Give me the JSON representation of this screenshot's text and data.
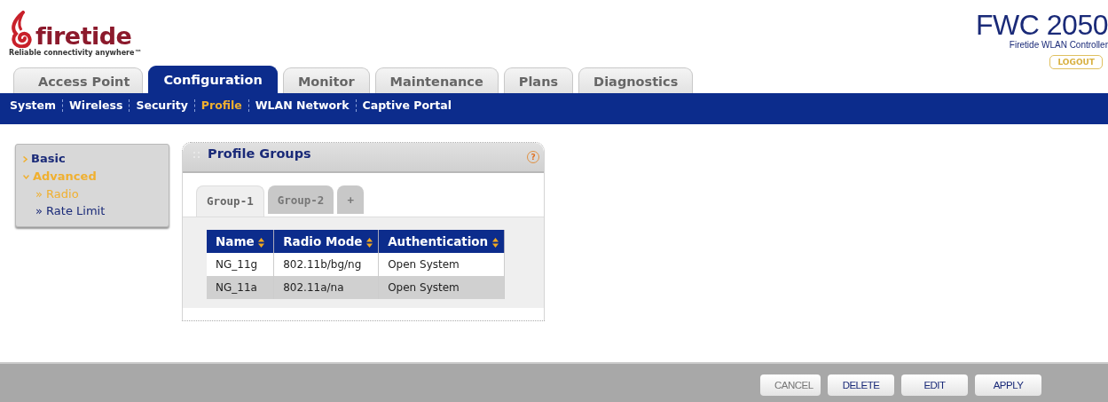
{
  "header": {
    "brand": "firetide",
    "tagline": "Reliable connectivity anywhere™",
    "product": "FWC 2050",
    "product_subtitle": "Firetide WLAN Controller",
    "logout": "LOGOUT"
  },
  "tabs": [
    {
      "label": "Access Point",
      "selected": false
    },
    {
      "label": "Configuration",
      "selected": true
    },
    {
      "label": "Monitor",
      "selected": false
    },
    {
      "label": "Maintenance",
      "selected": false
    },
    {
      "label": "Plans",
      "selected": false
    },
    {
      "label": "Diagnostics",
      "selected": false
    }
  ],
  "subnav": [
    {
      "label": "System",
      "selected": false
    },
    {
      "label": "Wireless",
      "selected": false
    },
    {
      "label": "Security",
      "selected": false
    },
    {
      "label": "Profile",
      "selected": true
    },
    {
      "label": "WLAN Network",
      "selected": false
    },
    {
      "label": "Captive Portal",
      "selected": false
    }
  ],
  "sidebar": {
    "items": [
      {
        "label": "Basic",
        "expanded": false
      },
      {
        "label": "Advanced",
        "expanded": true,
        "children": [
          {
            "label": "» Radio",
            "selected": true
          },
          {
            "label": "» Rate Limit",
            "selected": false
          }
        ]
      }
    ]
  },
  "panel": {
    "title": "Profile Groups",
    "help": "?",
    "group_tabs": [
      {
        "label": "Group-1",
        "selected": true
      },
      {
        "label": "Group-2",
        "selected": false
      },
      {
        "label": "+",
        "selected": false
      }
    ],
    "table": {
      "columns": [
        "Name",
        "Radio Mode",
        "Authentication"
      ],
      "rows": [
        [
          "NG_11g",
          "802.11b/bg/ng",
          "Open System"
        ],
        [
          "NG_11a",
          "802.11a/na",
          "Open System"
        ]
      ]
    }
  },
  "footer": {
    "buttons": [
      {
        "label": "CANCEL",
        "disabled": true
      },
      {
        "label": "DELETE",
        "disabled": false
      },
      {
        "label": "EDIT",
        "disabled": false
      },
      {
        "label": "APPLY",
        "disabled": false
      }
    ]
  }
}
